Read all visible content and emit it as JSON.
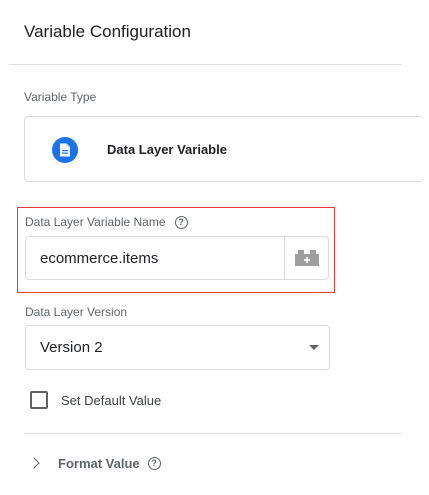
{
  "panel": {
    "title": "Variable Configuration"
  },
  "variable_type": {
    "label": "Variable Type",
    "selected": "Data Layer Variable",
    "icon": "document-icon",
    "icon_color": "#1a73e8"
  },
  "variable_name": {
    "label": "Data Layer Variable Name",
    "value": "ecommerce.items",
    "help_icon": "help-icon",
    "picker_icon": "variable-picker-icon",
    "highlight_color": "#e53935"
  },
  "data_layer_version": {
    "label": "Data Layer Version",
    "selected": "Version 2"
  },
  "default_value": {
    "label": "Set Default Value",
    "checked": false
  },
  "format_value": {
    "label": "Format Value",
    "expanded": false
  }
}
